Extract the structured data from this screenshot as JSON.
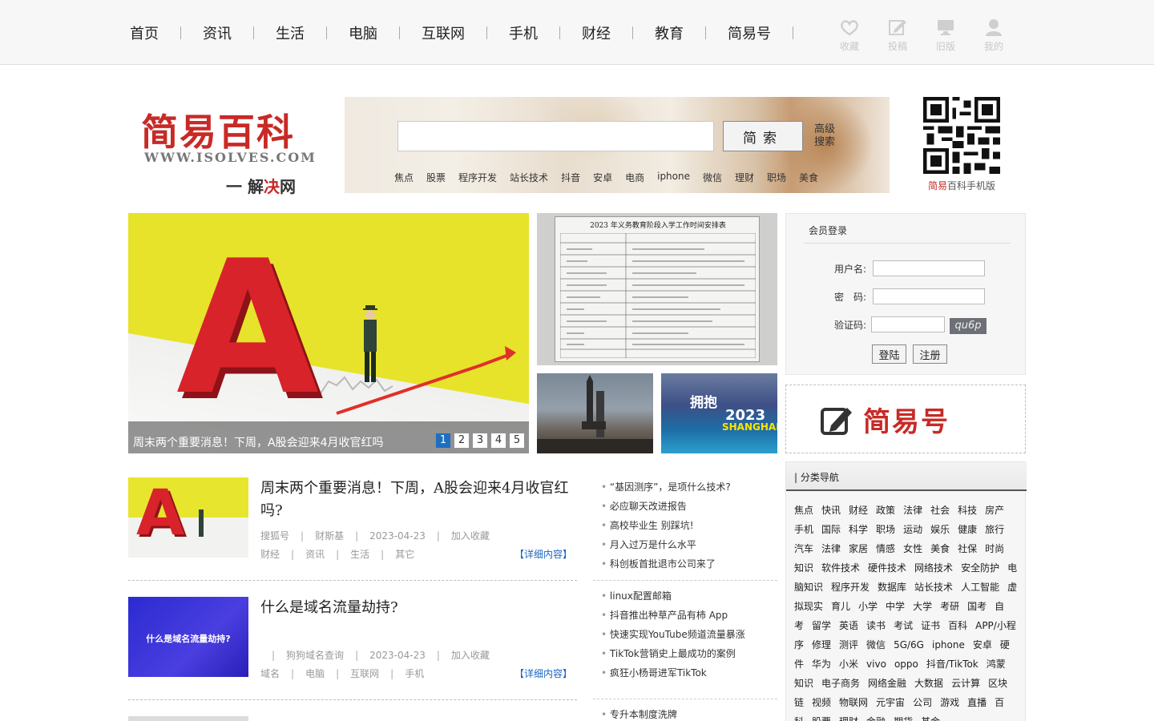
{
  "nav": {
    "items": [
      "首页",
      "资讯",
      "生活",
      "电脑",
      "互联网",
      "手机",
      "财经",
      "教育",
      "简易号"
    ],
    "icons": [
      {
        "name": "favorite",
        "label": "收藏"
      },
      {
        "name": "submit",
        "label": "投稿"
      },
      {
        "name": "old-version",
        "label": "旧版"
      },
      {
        "name": "my",
        "label": "我的"
      }
    ]
  },
  "logo": {
    "main": "简易百科",
    "url": "WWW.ISOLVES.COM",
    "sub_prefix": "一 解",
    "sub_red": "决",
    "sub_suffix": "网"
  },
  "search": {
    "placeholder": "",
    "button": "简索",
    "advanced": "高级搜索",
    "hot_links": [
      "焦点",
      "股票",
      "程序开发",
      "站长技术",
      "抖音",
      "安卓",
      "电商",
      "iphone",
      "微信",
      "理财",
      "职场",
      "美食"
    ]
  },
  "qr": {
    "caption_red": "简易",
    "caption_rest": "百科手机版"
  },
  "slider": {
    "caption": "周末两个重要消息！下周，A股会迎来4月收官红吗",
    "pages": [
      "1",
      "2",
      "3",
      "4",
      "5"
    ],
    "active_page": "1"
  },
  "side_photos": {
    "doc_title": "2023 年义务教育阶段入学工作时间安排表",
    "expo_line1": "拥抱",
    "expo_line2": "2023",
    "expo_line3": "SHANGHAI"
  },
  "login": {
    "title": "会员登录",
    "username_label": "用户名:",
    "password_label": "密　码:",
    "captcha_label": "验证码:",
    "captcha_text": "qu6p",
    "login_button": "登陆",
    "register_button": "注册"
  },
  "jianyihao": {
    "text": "简易号"
  },
  "category": {
    "title": "| 分类导航",
    "items": [
      "焦点",
      "快讯",
      "财经",
      "政策",
      "法律",
      "社会",
      "科技",
      "房产",
      "手机",
      "国际",
      "科学",
      "职场",
      "运动",
      "娱乐",
      "健康",
      "旅行",
      "汽车",
      "法律",
      "家居",
      "情感",
      "女性",
      "美食",
      "社保",
      "时尚",
      "知识",
      "软件技术",
      "硬件技术",
      "网络技术",
      "安全防护",
      "电脑知识",
      "程序开发",
      "数据库",
      "站长技术",
      "人工智能",
      "虚拟现实",
      "育儿",
      "小学",
      "中学",
      "大学",
      "考研",
      "国考",
      "自考",
      "留学",
      "英语",
      "读书",
      "考试",
      "证书",
      "百科",
      "APP/小程序",
      "修理",
      "测评",
      "微信",
      "5G/6G",
      "iphone",
      "安卓",
      "硬件",
      "华为",
      "小米",
      "vivo",
      "oppo",
      "抖音/TikTok",
      "鸿蒙",
      "知识",
      "电子商务",
      "网络金融",
      "大数据",
      "云计算",
      "区块链",
      "视频",
      "物联网",
      "元宇宙",
      "公司",
      "游戏",
      "直播",
      "百科",
      "股票",
      "理财",
      "金融",
      "期货",
      "基金"
    ]
  },
  "articles": [
    {
      "title": "周末两个重要消息！下周，A股会迎来4月收官红吗?",
      "source": "搜狐号",
      "author": "财斯基",
      "date": "2023-04-23",
      "fav": "加入收藏",
      "tags": [
        "财经",
        "资讯",
        "生活",
        "其它"
      ],
      "more": "【详细内容】"
    },
    {
      "title": "什么是域名流量劫持?",
      "source": "",
      "author": "狗狗域名查询",
      "date": "2023-04-23",
      "fav": "加入收藏",
      "tags": [
        "域名",
        "电脑",
        "互联网",
        "手机"
      ],
      "more": "【详细内容】",
      "thumb_text": "什么是域名流量劫持?"
    }
  ],
  "news_lists": [
    [
      "“基因测序”，是项什么技术?",
      "必应聊天改进报告",
      "高校毕业生 别踩坑!",
      "月入过万是什么水平",
      "科创板首批退市公司来了"
    ],
    [
      "linux配置邮箱",
      "抖音推出种草产品有柿 App",
      "快速实现YouTube频道流量暴涨",
      "TikTok营销史上最成功的案例",
      "疯狂小杨哥进军TikTok"
    ],
    [
      "专升本制度洗牌"
    ]
  ],
  "colors": {
    "brand_red": "#c82a26",
    "link_blue": "#1a64c4",
    "pager_active": "#1d6fc1"
  }
}
